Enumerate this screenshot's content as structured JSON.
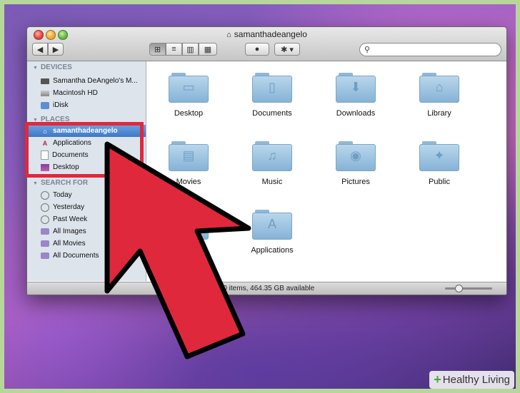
{
  "window": {
    "title": "samanthadeangelo"
  },
  "toolbar": {
    "nav_back": "◀",
    "nav_forward": "▶",
    "view_icons": "⊞",
    "view_list": "≡",
    "view_columns": "▥",
    "view_coverflow": "▦",
    "quicklook": "●",
    "action": "✱ ▾",
    "search_placeholder": ""
  },
  "sidebar": {
    "devices_header": "DEVICES",
    "devices": [
      {
        "label": "Samantha DeAngelo's M...",
        "icon": "laptop-icon"
      },
      {
        "label": "Macintosh HD",
        "icon": "hard-drive-icon"
      },
      {
        "label": "iDisk",
        "icon": "idisk-icon"
      }
    ],
    "places_header": "PLACES",
    "places": [
      {
        "label": "samanthadeangelo",
        "icon": "home-icon",
        "selected": true
      },
      {
        "label": "Applications",
        "icon": "applications-icon"
      },
      {
        "label": "Documents",
        "icon": "document-icon"
      },
      {
        "label": "Desktop",
        "icon": "desktop-icon"
      }
    ],
    "search_header": "SEARCH FOR",
    "search_items": [
      {
        "label": "Today",
        "icon": "clock-icon"
      },
      {
        "label": "Yesterday",
        "icon": "clock-icon"
      },
      {
        "label": "Past Week",
        "icon": "clock-icon"
      },
      {
        "label": "All Images",
        "icon": "smart-folder-icon"
      },
      {
        "label": "All Movies",
        "icon": "smart-folder-icon"
      },
      {
        "label": "All Documents",
        "icon": "smart-folder-icon"
      }
    ]
  },
  "folders": [
    {
      "label": "Desktop",
      "glyph": "▭"
    },
    {
      "label": "Documents",
      "glyph": "▯"
    },
    {
      "label": "Downloads",
      "glyph": "⬇"
    },
    {
      "label": "Library",
      "glyph": "⌂"
    },
    {
      "label": "Movies",
      "glyph": "▤"
    },
    {
      "label": "Music",
      "glyph": "♫"
    },
    {
      "label": "Pictures",
      "glyph": "◉"
    },
    {
      "label": "Public",
      "glyph": "✦"
    },
    {
      "label": "Applications",
      "glyph": "A"
    }
  ],
  "status": {
    "text": "10 items, 464.35 GB available",
    "zoom_level": 0.25
  },
  "watermark": {
    "plus": "+",
    "text": "Healthy Living"
  },
  "colors": {
    "highlight": "#e0283d",
    "selection": "#3d78c8"
  }
}
